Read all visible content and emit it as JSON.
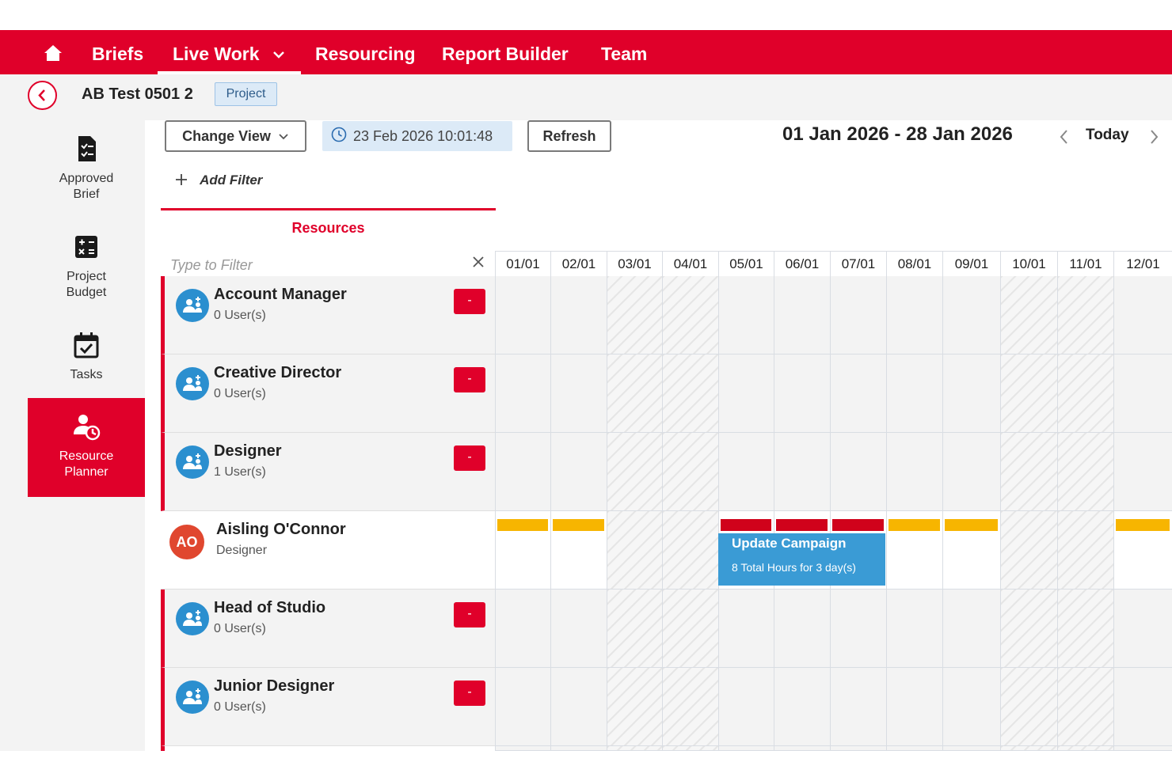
{
  "nav": {
    "home_icon": "home-icon",
    "items": [
      {
        "label": "Briefs"
      },
      {
        "label": "Live Work"
      },
      {
        "label": "Resourcing"
      },
      {
        "label": "Report Builder"
      },
      {
        "label": "Team"
      }
    ],
    "active": "Live Work",
    "color": "#e0002a"
  },
  "header": {
    "project_title": "AB Test 0501 2",
    "badge": "Project"
  },
  "sidebar": {
    "items": [
      {
        "label_line1": "Approved",
        "label_line2": "Brief",
        "icon": "document-checklist-icon"
      },
      {
        "label_line1": "Project",
        "label_line2": "Budget",
        "icon": "calculator-icon"
      },
      {
        "label_line1": "Tasks",
        "label_line2": "",
        "icon": "calendar-check-icon"
      },
      {
        "label_line1": "Resource",
        "label_line2": "Planner",
        "icon": "user-clock-icon"
      }
    ],
    "active": "Resource Planner"
  },
  "toolbar": {
    "change_view": "Change View",
    "timestamp": "23 Feb 2026 10:01:48",
    "refresh": "Refresh",
    "add_filter": "Add Filter",
    "date_range": "01 Jan 2026 - 28 Jan 2026",
    "today": "Today"
  },
  "resources": {
    "title": "Resources",
    "filter_placeholder": "Type to Filter",
    "rows": [
      {
        "type": "role",
        "name": "Account Manager",
        "sub": "0 User(s)",
        "action": "-"
      },
      {
        "type": "role",
        "name": "Creative Director",
        "sub": "0 User(s)",
        "action": "-"
      },
      {
        "type": "role",
        "name": "Designer",
        "sub": "1 User(s)",
        "action": "-"
      },
      {
        "type": "person",
        "name": "Aisling O'Connor",
        "sub": "Designer",
        "initials": "AO"
      },
      {
        "type": "role",
        "name": "Head of Studio",
        "sub": "0 User(s)",
        "action": "-"
      },
      {
        "type": "role",
        "name": "Junior Designer",
        "sub": "0 User(s)",
        "action": "-"
      }
    ]
  },
  "calendar": {
    "days": [
      "01/01",
      "02/01",
      "03/01",
      "04/01",
      "05/01",
      "06/01",
      "07/01",
      "08/01",
      "09/01",
      "10/01",
      "11/01",
      "12/01"
    ],
    "weekend_days": [
      "03/01",
      "04/01",
      "10/01",
      "11/01"
    ],
    "capacity": [
      {
        "day": "01/01",
        "status": "yellow"
      },
      {
        "day": "02/01",
        "status": "yellow"
      },
      {
        "day": "05/01",
        "status": "red"
      },
      {
        "day": "06/01",
        "status": "red"
      },
      {
        "day": "07/01",
        "status": "red"
      },
      {
        "day": "08/01",
        "status": "yellow"
      },
      {
        "day": "09/01",
        "status": "yellow"
      },
      {
        "day": "12/01",
        "status": "yellow"
      }
    ],
    "colors": {
      "yellow": "#f7b500",
      "red": "#d0021b",
      "task": "#3a9bd5"
    },
    "task": {
      "title": "Update Campaign",
      "hours": "8 Total Hours for 3 day(s)",
      "start_day": "05/01",
      "end_day": "07/01"
    }
  }
}
